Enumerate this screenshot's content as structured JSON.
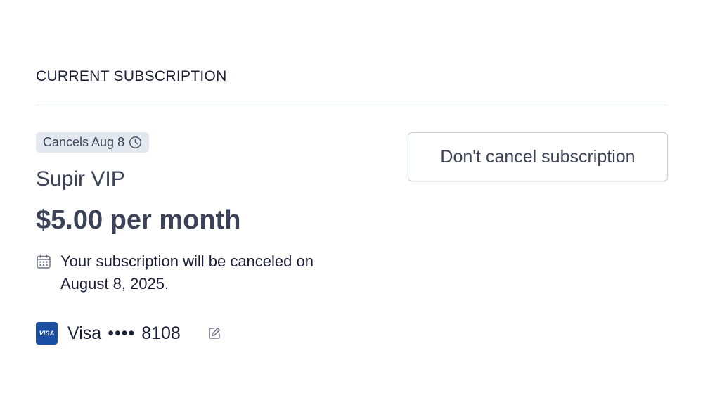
{
  "section": {
    "title": "CURRENT SUBSCRIPTION"
  },
  "subscription": {
    "status_badge": "Cancels Aug 8",
    "status_icon": "clock-icon",
    "plan_name": "Supir VIP",
    "price": "$5.00 per month",
    "notice_icon": "calendar-icon",
    "notice_text": "Your subscription will be canceled on August 8, 2025."
  },
  "payment": {
    "brand_logo": "VISA",
    "card_label": "Visa",
    "masked": "••••",
    "last4": "8108",
    "edit_icon": "edit-icon"
  },
  "actions": {
    "dont_cancel_label": "Don't cancel subscription"
  },
  "colors": {
    "text_primary": "#1a1f36",
    "text_secondary": "#3c4257",
    "badge_bg": "#e3e8ee",
    "divider": "#e3e8ee",
    "visa_blue": "#1a4ea3",
    "icon_gray": "#6b7385"
  }
}
